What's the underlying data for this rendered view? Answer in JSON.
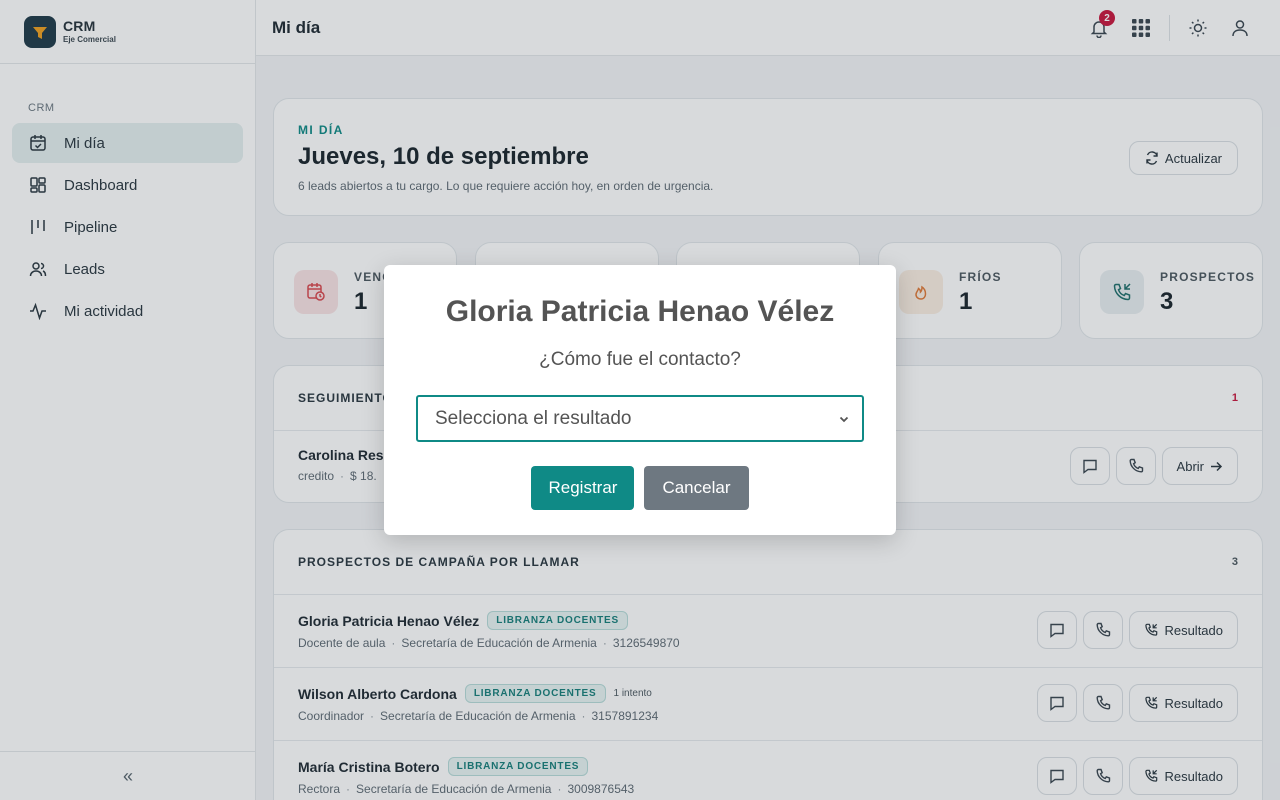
{
  "brand": {
    "title": "CRM",
    "subtitle": "Eje Comercial"
  },
  "sidebar": {
    "section": "CRM",
    "items": [
      {
        "label": "Mi día",
        "icon": "calendar-check-icon",
        "active": true
      },
      {
        "label": "Dashboard",
        "icon": "dashboard-icon"
      },
      {
        "label": "Pipeline",
        "icon": "pipeline-icon"
      },
      {
        "label": "Leads",
        "icon": "users-icon"
      },
      {
        "label": "Mi actividad",
        "icon": "activity-icon"
      }
    ],
    "collapse_label": "«"
  },
  "topbar": {
    "title": "Mi día",
    "notifications_count": "2"
  },
  "hero": {
    "eyebrow": "MI DÍA",
    "title": "Jueves, 10 de septiembre",
    "subtitle": "6 leads abiertos a tu cargo. Lo que requiere acción hoy, en orden de urgencia.",
    "refresh_label": "Actualizar"
  },
  "stats": [
    {
      "label": "VENC",
      "value": "1",
      "color": "#f9e3e5"
    },
    {
      "label": "",
      "value": "",
      "color": "#ffffff"
    },
    {
      "label": "",
      "value": "",
      "color": "#ffffff"
    },
    {
      "label": "FRÍOS",
      "value": "1",
      "color": "#fbeee2"
    },
    {
      "label": "PROSPECTOS",
      "value": "3",
      "color": "#e8eef1"
    }
  ],
  "followups": {
    "title": "SEGUIMIENTO",
    "count": "1",
    "rows": [
      {
        "name": "Carolina Res",
        "meta_a": "credito",
        "meta_b": "$ 18.",
        "open_label": "Abrir"
      }
    ]
  },
  "prospects": {
    "title": "PROSPECTOS DE CAMPAÑA POR LLAMAR",
    "count": "3",
    "action_label": "Resultado",
    "rows": [
      {
        "name": "Gloria Patricia Henao Vélez",
        "tag": "LIBRANZA DOCENTES",
        "attempts": "",
        "role": "Docente de aula",
        "org": "Secretaría de Educación de Armenia",
        "phone": "3126549870"
      },
      {
        "name": "Wilson Alberto Cardona",
        "tag": "LIBRANZA DOCENTES",
        "attempts": "1 intento",
        "role": "Coordinador",
        "org": "Secretaría de Educación de Armenia",
        "phone": "3157891234"
      },
      {
        "name": "María Cristina Botero",
        "tag": "LIBRANZA DOCENTES",
        "attempts": "",
        "role": "Rectora",
        "org": "Secretaría de Educación de Armenia",
        "phone": "3009876543"
      }
    ]
  },
  "modal": {
    "title": "Gloria Patricia Henao Vélez",
    "question": "¿Cómo fue el contacto?",
    "select_placeholder": "Selecciona el resultado",
    "confirm_label": "Registrar",
    "cancel_label": "Cancelar"
  },
  "colors": {
    "accent": "#0f8a86",
    "danger": "#c8173d",
    "muted_button": "#6e7881"
  }
}
